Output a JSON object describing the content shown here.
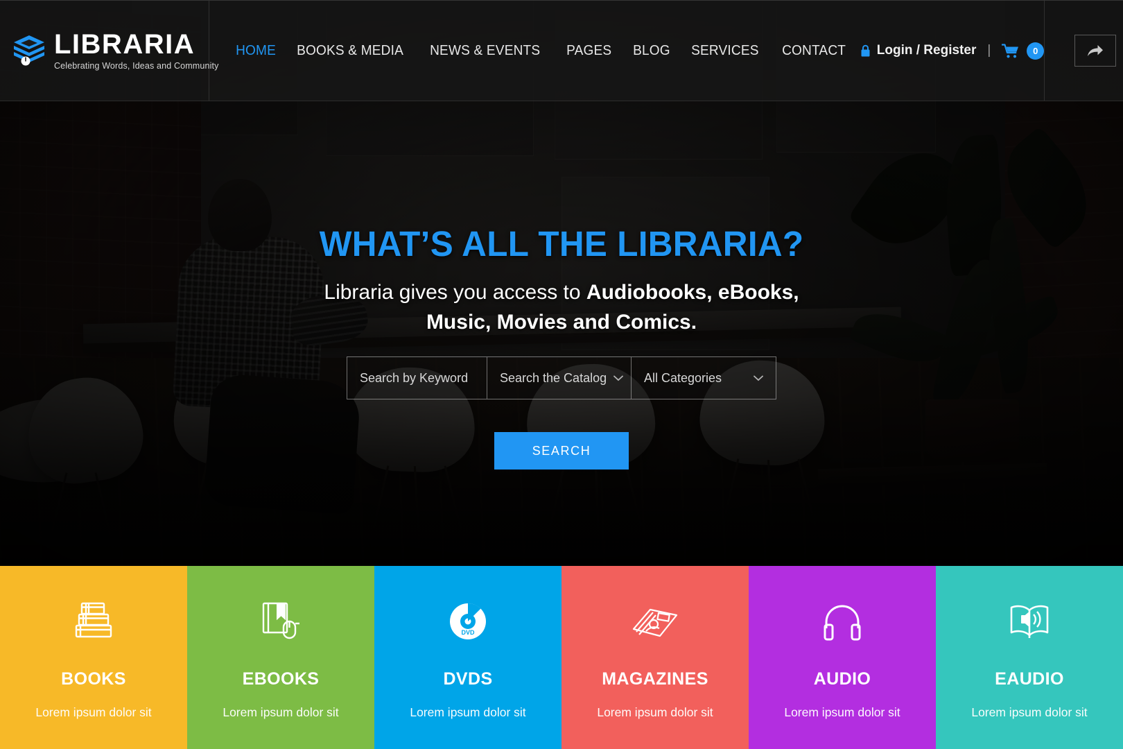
{
  "brand": {
    "name": "LIBRARIA",
    "tagline": "Celebrating Words, Ideas and Community",
    "logo_icon": "stacked-books-logo-icon",
    "accent_color": "#2196f3"
  },
  "nav": {
    "items": [
      {
        "label": "HOME",
        "active": true
      },
      {
        "label": "BOOKS & MEDIA",
        "active": false
      },
      {
        "label": "NEWS & EVENTS",
        "active": false
      },
      {
        "label": "PAGES",
        "active": false
      },
      {
        "label": "BLOG",
        "active": false
      },
      {
        "label": "SERVICES",
        "active": false
      },
      {
        "label": "CONTACT",
        "active": false
      }
    ]
  },
  "header_right": {
    "lock_icon": "lock-icon",
    "login_label": "Login / Register",
    "separator": "|",
    "cart_icon": "shopping-cart-icon",
    "cart_count": "0",
    "share_icon": "share-arrow-icon"
  },
  "hero": {
    "title": "WHAT’S ALL THE LIBRARIA?",
    "subtitle_plain": "Libraria gives you access to ",
    "subtitle_bold": "Audiobooks, eBooks, Music, Movies and Comics.",
    "search": {
      "keyword_placeholder": "Search by Keyword",
      "catalog_value": "Search the Catalog",
      "category_value": "All Categories",
      "chevron_icon": "chevron-down-icon",
      "button_label": "SEARCH"
    }
  },
  "categories": [
    {
      "title": "BOOKS",
      "desc": "Lorem ipsum dolor sit",
      "color": "#f7b928",
      "icon": "stacked-books-icon"
    },
    {
      "title": "EBOOKS",
      "desc": "Lorem ipsum dolor sit",
      "color": "#7dbc45",
      "icon": "ebook-mouse-icon"
    },
    {
      "title": "DVDS",
      "desc": "Lorem ipsum dolor sit",
      "color": "#00a5e8",
      "icon": "dvd-disc-icon"
    },
    {
      "title": "MAGAZINES",
      "desc": "Lorem ipsum dolor sit",
      "color": "#f2605c",
      "icon": "magazines-icon"
    },
    {
      "title": "AUDIO",
      "desc": "Lorem ipsum dolor sit",
      "color": "#b32ee0",
      "icon": "headphones-icon"
    },
    {
      "title": "EAUDIO",
      "desc": "Lorem ipsum dolor sit",
      "color": "#35c6bd",
      "icon": "audiobook-speaker-icon"
    }
  ]
}
